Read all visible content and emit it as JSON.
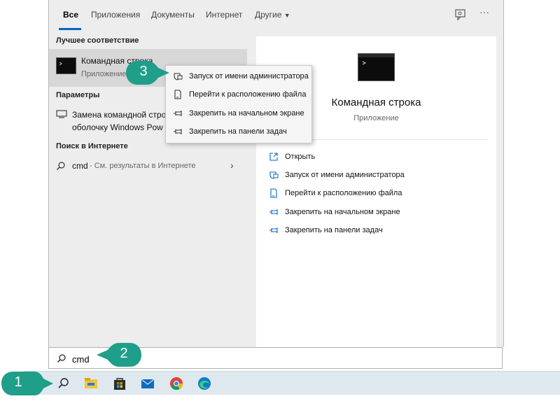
{
  "tabs": [
    {
      "label": "Все",
      "active": true
    },
    {
      "label": "Приложения"
    },
    {
      "label": "Документы"
    },
    {
      "label": "Интернет"
    },
    {
      "label": "Другие"
    }
  ],
  "results": {
    "best_match_heading": "Лучшее соответствие",
    "best_match": {
      "title": "Командная строка",
      "subtitle": "Приложение"
    },
    "settings_heading": "Параметры",
    "setting_item": {
      "line1": "Замена командной стро",
      "line2": "оболочку Windows Pow"
    },
    "web_heading": "Поиск в Интернете",
    "web_item": {
      "query": "cmd",
      "suffix": " - См. результаты в Интернете"
    }
  },
  "preview": {
    "title": "Командная строка",
    "subtitle": "Приложение",
    "actions": [
      {
        "label": "Открыть",
        "icon": "open-icon"
      },
      {
        "label": "Запуск от имени администратора",
        "icon": "shield-icon"
      },
      {
        "label": "Перейти к расположению файла",
        "icon": "file-icon"
      },
      {
        "label": "Закрепить на начальном экране",
        "icon": "pin-icon"
      },
      {
        "label": "Закрепить на панели задач",
        "icon": "pin-icon"
      }
    ]
  },
  "context_menu": [
    {
      "label": "Запуск от имени администратора",
      "icon": "shield-icon"
    },
    {
      "label": "Перейти к расположению файла",
      "icon": "file-icon"
    },
    {
      "label": "Закрепить на начальном экране",
      "icon": "pin-icon"
    },
    {
      "label": "Закрепить на панели задач",
      "icon": "pin-icon"
    }
  ],
  "search": {
    "value": "cmd"
  },
  "taskbar_icons": [
    "search-icon",
    "file-explorer-icon",
    "store-icon",
    "mail-icon",
    "chrome-icon",
    "edge-icon"
  ],
  "callouts": [
    "1",
    "2",
    "3"
  ],
  "colors": {
    "accent": "#0067c0",
    "callout": "#1f9e89",
    "selected_row": "#d7d7d7"
  }
}
